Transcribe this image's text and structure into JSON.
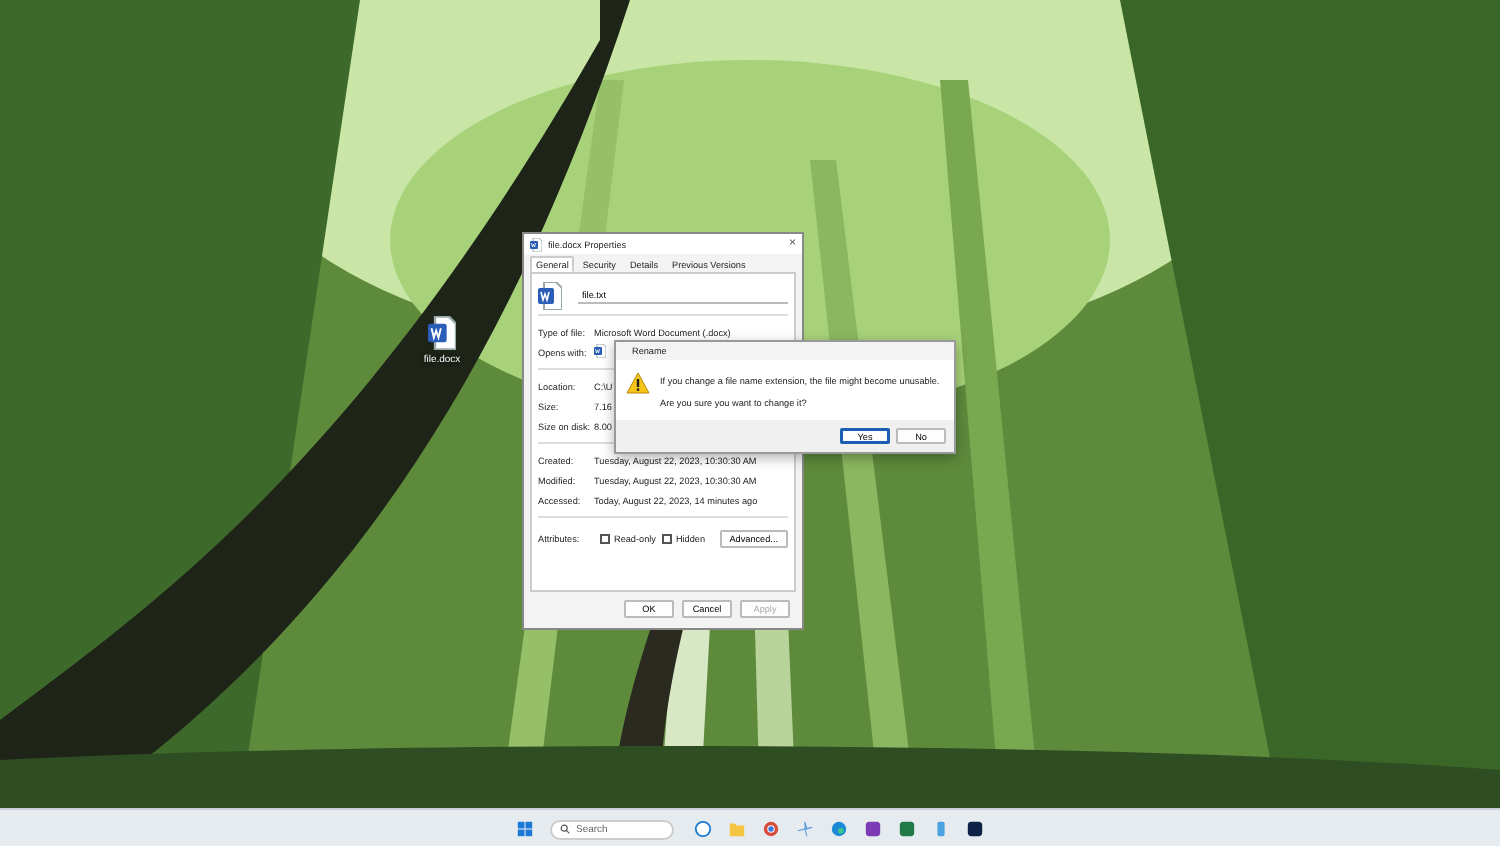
{
  "desktop_icons": [
    {
      "label": "file.docx"
    }
  ],
  "properties_window": {
    "title": "file.docx Properties",
    "close_button": "×",
    "tabs": [
      {
        "label": "General",
        "selected": true
      },
      {
        "label": "Security",
        "selected": false
      },
      {
        "label": "Details",
        "selected": false
      },
      {
        "label": "Previous Versions",
        "selected": false
      }
    ],
    "file_name": "file.txt",
    "type_fields": [
      {
        "label": "Type of file:",
        "value": "Microsoft Word Document (.docx)"
      },
      {
        "label": "Opens with:",
        "kind": "app_icon"
      }
    ],
    "location_fields": [
      {
        "label": "Location:",
        "value": "C:\\U"
      },
      {
        "label": "Size:",
        "value": "7.16"
      },
      {
        "label": "Size on disk:",
        "value": "8.00"
      }
    ],
    "date_fields": [
      {
        "label": "Created:",
        "value": "Tuesday, August 22, 2023, 10:30:30 AM"
      },
      {
        "label": "Modified:",
        "value": "Tuesday, August 22, 2023, 10:30:30 AM"
      },
      {
        "label": "Accessed:",
        "value": "Today, August 22, 2023, 14 minutes ago"
      }
    ],
    "attributes_label": "Attributes:",
    "attributes": [
      {
        "label": "Read-only",
        "checked": false
      },
      {
        "label": "Hidden",
        "checked": false
      }
    ],
    "advanced_button": "Advanced...",
    "buttons": [
      {
        "label": "OK",
        "disabled": false
      },
      {
        "label": "Cancel",
        "disabled": false
      },
      {
        "label": "Apply",
        "disabled": true
      }
    ]
  },
  "rename_dialog": {
    "title": "Rename",
    "message": "If you change a file name extension, the file might become unusable.",
    "question": "Are you sure you want to change it?",
    "buttons": [
      {
        "label": "Yes",
        "selected": true
      },
      {
        "label": "No",
        "selected": false
      }
    ]
  },
  "taskbar": {
    "search_placeholder": "Search"
  }
}
